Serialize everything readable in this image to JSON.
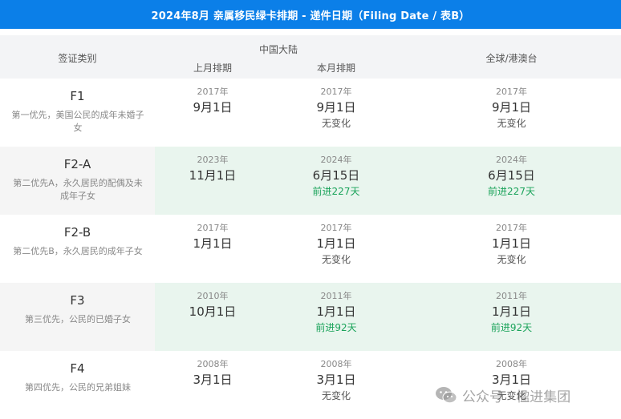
{
  "title": "2024年8月 亲属移民绿卡排期 - 递件日期（Filing Date / 表B）",
  "header": {
    "category": "签证类别",
    "mainland": "中国大陆",
    "last_month": "上月排期",
    "this_month": "本月排期",
    "global": "全球/港澳台"
  },
  "rows": [
    {
      "code": "F1",
      "desc": "第一优先，美国公民的成年未婚子女",
      "last": {
        "year": "2017年",
        "date": "9月1日"
      },
      "this": {
        "year": "2017年",
        "date": "9月1日",
        "change": "无变化"
      },
      "global": {
        "year": "2017年",
        "date": "9月1日",
        "change": "无变化"
      }
    },
    {
      "code": "F2-A",
      "desc": "第二优先A，永久居民的配偶及未成年子女",
      "last": {
        "year": "2023年",
        "date": "11月1日"
      },
      "this": {
        "year": "2024年",
        "date": "6月15日",
        "change": "前进227天"
      },
      "global": {
        "year": "2024年",
        "date": "6月15日",
        "change": "前进227天"
      }
    },
    {
      "code": "F2-B",
      "desc": "第二优先B，永久居民的成年子女",
      "last": {
        "year": "2017年",
        "date": "1月1日"
      },
      "this": {
        "year": "2017年",
        "date": "1月1日",
        "change": "无变化"
      },
      "global": {
        "year": "2017年",
        "date": "1月1日",
        "change": "无变化"
      }
    },
    {
      "code": "F3",
      "desc": "第三优先，公民的已婚子女",
      "last": {
        "year": "2010年",
        "date": "10月1日"
      },
      "this": {
        "year": "2011年",
        "date": "1月1日",
        "change": "前进92天"
      },
      "global": {
        "year": "2011年",
        "date": "1月1日",
        "change": "前进92天"
      }
    },
    {
      "code": "F4",
      "desc": "第四优先，公民的兄弟姐妹",
      "last": {
        "year": "2008年",
        "date": "3月1日"
      },
      "this": {
        "year": "2008年",
        "date": "3月1日",
        "change": "无变化"
      },
      "global": {
        "year": "2008年",
        "date": "3月1日",
        "change": "无变化"
      }
    }
  ],
  "colors": {
    "title_bg": "#0b7fe8",
    "header_bg": "#f3f4f6",
    "highlight_bg": "#e9f5ee",
    "advance_text": "#1aa35a"
  },
  "watermark": {
    "icon": "wechat-icon",
    "text": "公众号 · 楹进集团"
  }
}
